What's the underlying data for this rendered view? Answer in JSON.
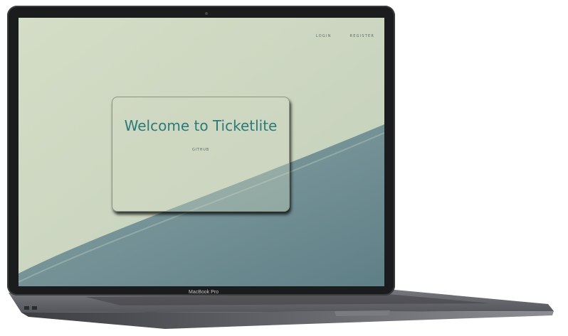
{
  "app": {
    "nav": {
      "login": "LOGIN",
      "register": "REGISTER"
    },
    "hero": {
      "title": "Welcome to Ticketlite",
      "github": "GITHUB"
    }
  },
  "device": {
    "model_label": "MacBook Pro"
  },
  "colors": {
    "screen_bg": "#cdd8c1",
    "accent_title": "#2e7a78",
    "wave_blue": "#6e8e95",
    "laptop_body": "#5a5b60"
  }
}
